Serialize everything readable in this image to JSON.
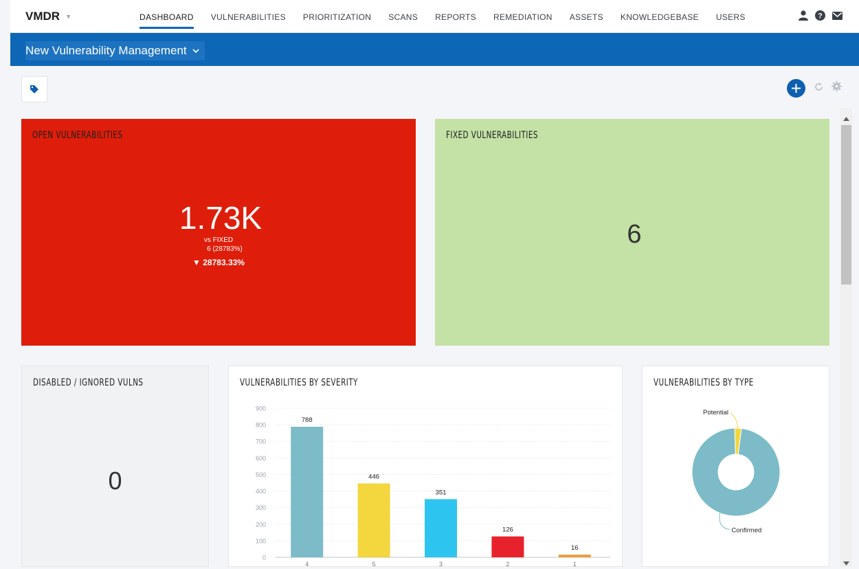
{
  "app": {
    "name": "VMDR"
  },
  "nav": {
    "items": [
      "DASHBOARD",
      "VULNERABILITIES",
      "PRIORITIZATION",
      "SCANS",
      "REPORTS",
      "REMEDIATION",
      "ASSETS",
      "KNOWLEDGEBASE",
      "USERS"
    ],
    "active": "DASHBOARD"
  },
  "dashboard": {
    "title": "New Vulnerability Management"
  },
  "colors": {
    "brand_blue": "#0e66b6",
    "open_red": "#de1e0a",
    "fixed_green": "#c4e1a6"
  },
  "widgets": {
    "open": {
      "title": "OPEN VULNERABILITIES",
      "value": "1.73K",
      "vs_label": "vs FIXED",
      "vs_value": "6 (28783%)",
      "change": "▼ 28783.33%"
    },
    "fixed": {
      "title": "FIXED VULNERABILITIES",
      "value": "6"
    },
    "disabled": {
      "title": "DISABLED / IGNORED VULNS",
      "value": "0"
    },
    "severity": {
      "title": "VULNERABILITIES BY SEVERITY"
    },
    "type": {
      "title": "VULNERABILITIES BY TYPE"
    }
  },
  "chart_data": [
    {
      "type": "bar",
      "title": "VULNERABILITIES BY SEVERITY",
      "categories": [
        "4",
        "5",
        "3",
        "2",
        "1"
      ],
      "values": [
        788,
        446,
        351,
        126,
        16
      ],
      "colors": [
        "#7dbbc8",
        "#f4d63e",
        "#2ec4f0",
        "#e8222c",
        "#f0993a"
      ],
      "ylim": [
        0,
        900
      ],
      "yticks": [
        0,
        100,
        200,
        300,
        400,
        500,
        600,
        700,
        800,
        900
      ],
      "grid": true
    },
    {
      "type": "pie",
      "title": "VULNERABILITIES BY TYPE",
      "labels": [
        "Confirmed",
        "Potential"
      ],
      "values": [
        1684,
        43
      ],
      "colors": [
        "#7dbbc8",
        "#f4d63e"
      ]
    }
  ]
}
